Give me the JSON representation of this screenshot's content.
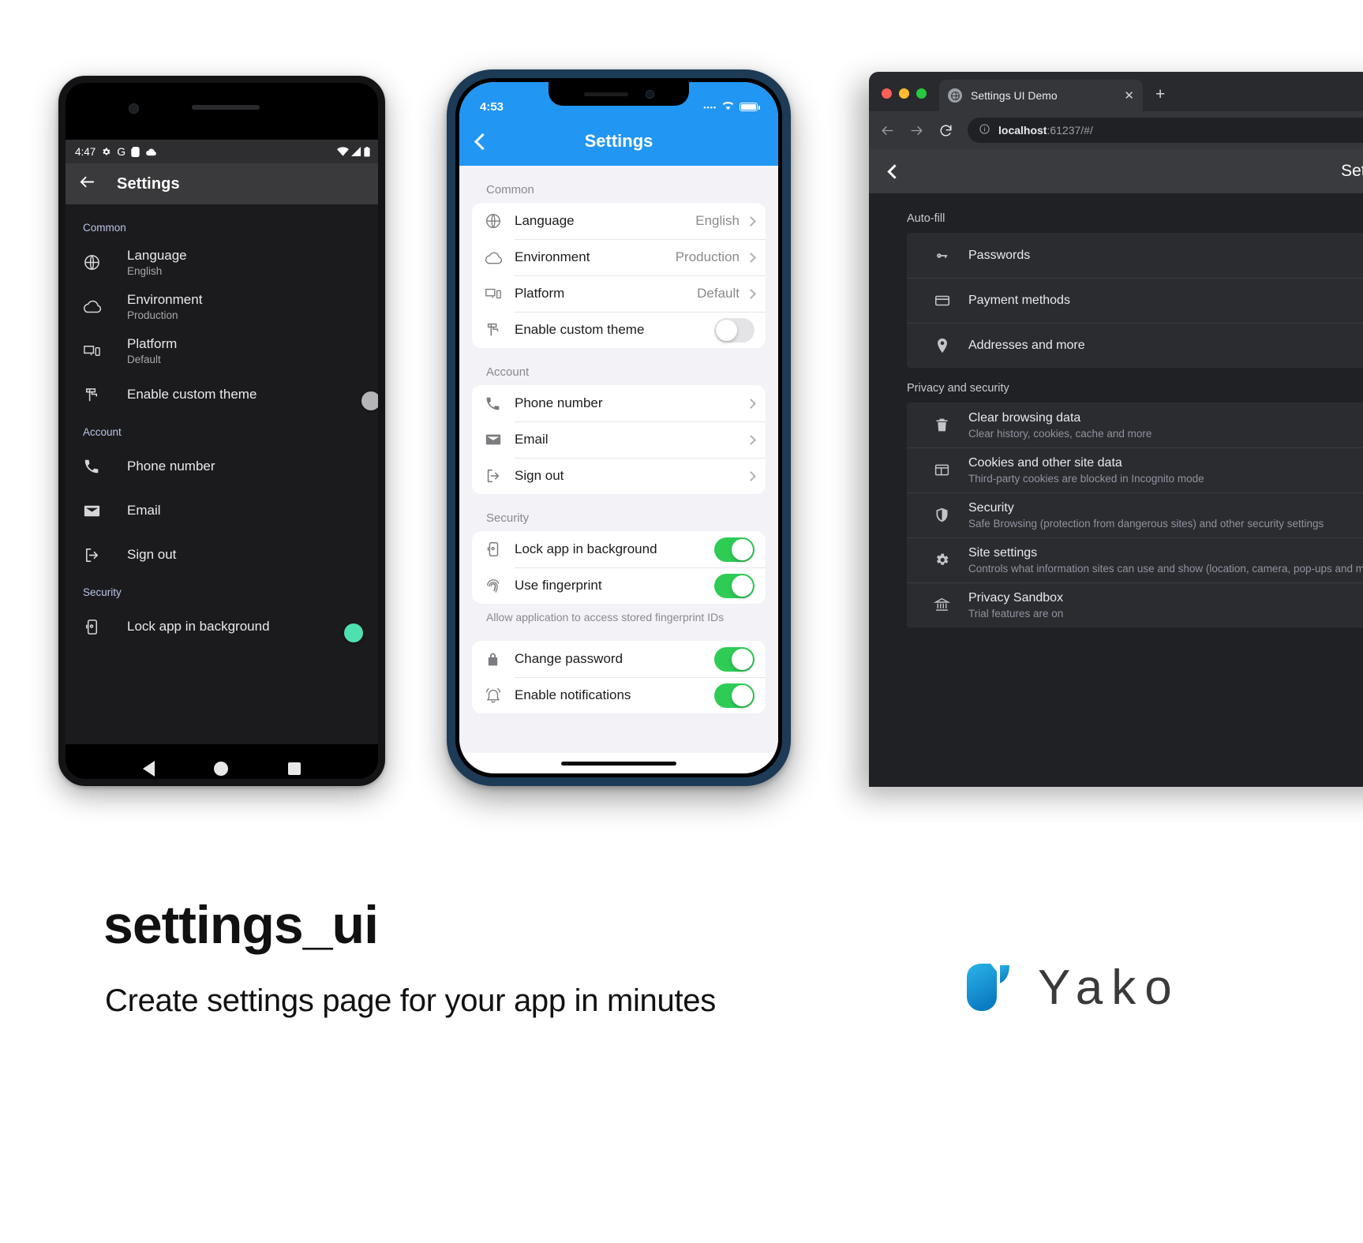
{
  "android": {
    "status_bar": {
      "time": "4:47",
      "icons": [
        "gear-icon",
        "google-icon",
        "sdcard-icon",
        "cloud-icon"
      ],
      "right_icons": [
        "wifi-icon",
        "signal-icon",
        "battery-icon"
      ]
    },
    "app_bar": {
      "back": "back-arrow-icon",
      "title": "Settings"
    },
    "sections": [
      {
        "header": "Common",
        "rows": [
          {
            "icon": "globe-icon",
            "title": "Language",
            "subtitle": "English",
            "control": "none"
          },
          {
            "icon": "cloud-icon",
            "title": "Environment",
            "subtitle": "Production",
            "control": "none"
          },
          {
            "icon": "devices-icon",
            "title": "Platform",
            "subtitle": "Default",
            "control": "none"
          },
          {
            "icon": "paint-roller-icon",
            "title": "Enable custom theme",
            "subtitle": "",
            "control": "switch",
            "value": "off"
          }
        ]
      },
      {
        "header": "Account",
        "rows": [
          {
            "icon": "phone-icon",
            "title": "Phone number",
            "subtitle": "",
            "control": "none"
          },
          {
            "icon": "email-icon",
            "title": "Email",
            "subtitle": "",
            "control": "none"
          },
          {
            "icon": "sign-out-icon",
            "title": "Sign out",
            "subtitle": "",
            "control": "none"
          }
        ]
      },
      {
        "header": "Security",
        "rows": [
          {
            "icon": "phone-lock-icon",
            "title": "Lock app in background",
            "subtitle": "",
            "control": "switch",
            "value": "on"
          }
        ]
      }
    ],
    "nav_bar": [
      "back-triangle-icon",
      "home-circle-icon",
      "recents-square-icon"
    ]
  },
  "ios": {
    "status_bar": {
      "time": "4:53",
      "right_icons": [
        "signal-dots-icon",
        "wifi-icon",
        "battery-icon"
      ]
    },
    "app_bar": {
      "back": "chevron-left-icon",
      "title": "Settings"
    },
    "sections": [
      {
        "header": "Common",
        "rows": [
          {
            "icon": "globe-icon",
            "label": "Language",
            "value": "English",
            "control": "chevron"
          },
          {
            "icon": "cloud-icon",
            "label": "Environment",
            "value": "Production",
            "control": "chevron"
          },
          {
            "icon": "devices-icon",
            "label": "Platform",
            "value": "Default",
            "control": "chevron"
          },
          {
            "icon": "paint-roller-icon",
            "label": "Enable custom theme",
            "value": "",
            "control": "switch",
            "switch_value": "off"
          }
        ],
        "footnote": ""
      },
      {
        "header": "Account",
        "rows": [
          {
            "icon": "phone-icon",
            "label": "Phone number",
            "value": "",
            "control": "chevron"
          },
          {
            "icon": "email-icon",
            "label": "Email",
            "value": "",
            "control": "chevron"
          },
          {
            "icon": "sign-out-icon",
            "label": "Sign out",
            "value": "",
            "control": "chevron"
          }
        ],
        "footnote": ""
      },
      {
        "header": "Security",
        "rows": [
          {
            "icon": "phone-lock-icon",
            "label": "Lock app in background",
            "value": "",
            "control": "switch",
            "switch_value": "on"
          },
          {
            "icon": "fingerprint-icon",
            "label": "Use fingerprint",
            "value": "",
            "control": "switch",
            "switch_value": "on"
          }
        ],
        "footnote": "Allow application to access stored fingerprint IDs"
      },
      {
        "header": "",
        "rows": [
          {
            "icon": "lock-icon",
            "label": "Change password",
            "value": "",
            "control": "switch",
            "switch_value": "on"
          },
          {
            "icon": "bell-icon",
            "label": "Enable notifications",
            "value": "",
            "control": "switch",
            "switch_value": "on"
          }
        ],
        "footnote": ""
      }
    ]
  },
  "browser": {
    "traffic_lights": {
      "close": "#ff5f57",
      "minimize": "#febc2e",
      "zoom": "#28c840"
    },
    "tab": {
      "favicon": "globe-icon",
      "title": "Settings UI Demo",
      "close": "close-icon"
    },
    "new_tab_label": "+",
    "toolbar": {
      "back": "back-arrow-icon",
      "forward": "forward-arrow-icon",
      "reload": "reload-icon"
    },
    "omnibox": {
      "info_icon": "info-icon",
      "host": "localhost",
      "path": ":61237/#/"
    },
    "page": {
      "app_bar": {
        "back": "chevron-left-icon",
        "title": "Settings"
      },
      "sections": [
        {
          "header": "Auto-fill",
          "rows": [
            {
              "icon": "key-icon",
              "title": "Passwords",
              "subtitle": ""
            },
            {
              "icon": "credit-card-icon",
              "title": "Payment methods",
              "subtitle": ""
            },
            {
              "icon": "location-pin-icon",
              "title": "Addresses and more",
              "subtitle": ""
            }
          ]
        },
        {
          "header": "Privacy and security",
          "rows": [
            {
              "icon": "trash-icon",
              "title": "Clear browsing data",
              "subtitle": "Clear history, cookies, cache and more"
            },
            {
              "icon": "cookie-panel-icon",
              "title": "Cookies and other site data",
              "subtitle": "Third-party cookies are blocked in Incognito mode"
            },
            {
              "icon": "shield-icon",
              "title": "Security",
              "subtitle": "Safe Browsing (protection from dangerous sites) and other security settings"
            },
            {
              "icon": "gear-icon",
              "title": "Site settings",
              "subtitle": "Controls what information sites can use and show (location, camera, pop-ups and more)"
            },
            {
              "icon": "bank-icon",
              "title": "Privacy Sandbox",
              "subtitle": "Trial features are on"
            }
          ]
        }
      ]
    }
  },
  "footer": {
    "title": "settings_ui",
    "subtitle": "Create settings page for your app in minutes",
    "brand": {
      "name": "Yako",
      "logo_icon": "yako-droplet-logo",
      "logo_color_light": "#29abe2",
      "logo_color_dark": "#0d80c4"
    }
  }
}
